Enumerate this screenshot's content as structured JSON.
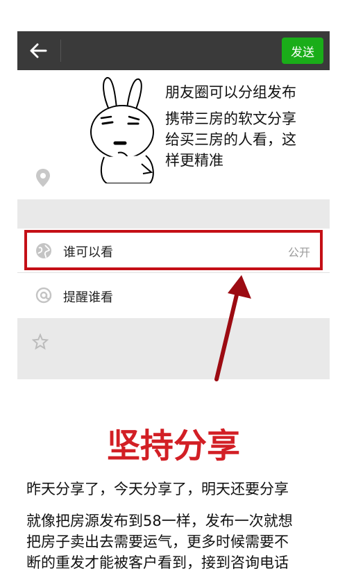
{
  "top_bar": {
    "send_label": "发送",
    "back_icon": "back-arrow-icon",
    "accent_color": "#1aad19"
  },
  "annotation": {
    "title": "朋友圈可以分组发布",
    "lines": [
      "携带三房的软文分享",
      "给买三房的人看，这",
      "样更精准"
    ]
  },
  "settings_list": {
    "visibility_row": {
      "label": "谁可以看",
      "value": "公开",
      "icon": "globe-icon"
    },
    "remind_row": {
      "label": "提醒谁看",
      "icon": "at-icon"
    },
    "location_icon": "location-pin-icon",
    "favorite_icon": "star-icon",
    "highlight_color": "#c40f16"
  },
  "content": {
    "headline": "坚持分享",
    "headline_color": "#d21f25",
    "paragraph_1": "昨天分享了，今天分享了，明天还要分享",
    "paragraph_2_lines": [
      "就像把房源发布到58一样，发布一次就想",
      "把房子卖出去需要运气，更多时候需要不",
      "断的重发才能被客户看到，接到咨询电话"
    ]
  }
}
